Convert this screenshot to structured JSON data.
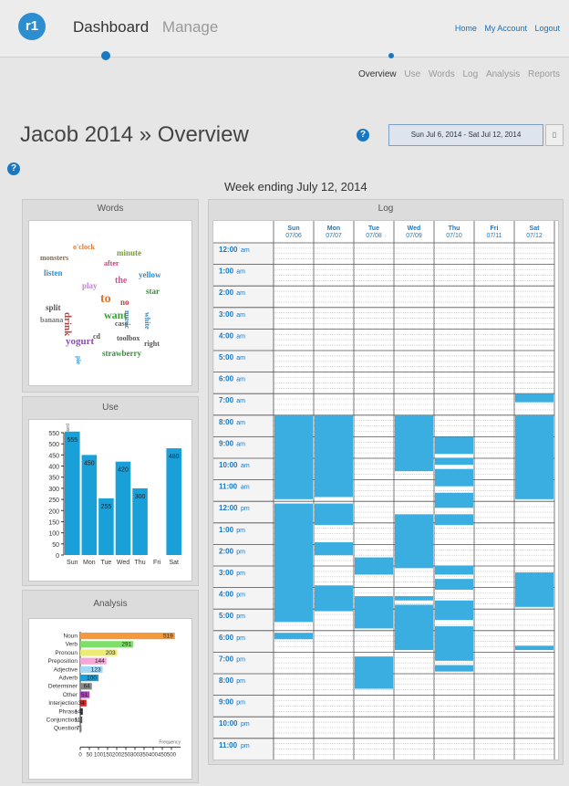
{
  "nav": {
    "dashboard": "Dashboard",
    "manage": "Manage",
    "home": "Home",
    "account": "My Account",
    "logout": "Logout",
    "logo_text": "r1"
  },
  "subnav": [
    "Overview",
    "Use",
    "Words",
    "Log",
    "Analysis",
    "Reports"
  ],
  "page_title": "Jacob 2014 » Overview",
  "help_icon": "?",
  "date_range": "Sun Jul 6, 2014 - Sat Jul 12, 2014",
  "week_heading": "Week ending July 12, 2014",
  "panels": {
    "words": "Words",
    "use": "Use",
    "analysis": "Analysis",
    "log": "Log"
  },
  "word_cloud": [
    {
      "t": "o'clock",
      "c": "#e0762a"
    },
    {
      "t": "monsters",
      "c": "#8a6a4a"
    },
    {
      "t": "minute",
      "c": "#7a9a3a"
    },
    {
      "t": "after",
      "c": "#c04080"
    },
    {
      "t": "listen",
      "c": "#2d8ecf"
    },
    {
      "t": "yellow",
      "c": "#2d8ecf"
    },
    {
      "t": "the",
      "c": "#d84c9c"
    },
    {
      "t": "play",
      "c": "#c080e0"
    },
    {
      "t": "star",
      "c": "#3a8a3a"
    },
    {
      "t": "to",
      "c": "#e0762a"
    },
    {
      "t": "no",
      "c": "#c04040"
    },
    {
      "t": "split",
      "c": "#555"
    },
    {
      "t": "want",
      "c": "#3aa03a"
    },
    {
      "t": "banana",
      "c": "#777"
    },
    {
      "t": "case",
      "c": "#555"
    },
    {
      "t": "drink",
      "c": "#c04040"
    },
    {
      "t": "cd",
      "c": "#555"
    },
    {
      "t": "toolbox",
      "c": "#555"
    },
    {
      "t": "yogurt",
      "c": "#8a50b0"
    },
    {
      "t": "right",
      "c": "#555"
    },
    {
      "t": "strawberry",
      "c": "#3a8a3a"
    },
    {
      "t": "music",
      "c": "#2d8ecf"
    },
    {
      "t": "white",
      "c": "#2d8ecf"
    },
    {
      "t": "pie",
      "c": "#2d8ecf"
    }
  ],
  "use_chart": {
    "ylabel": "Minutes used",
    "yticks": [
      0,
      50,
      100,
      150,
      200,
      250,
      300,
      350,
      400,
      450,
      500,
      550
    ],
    "categories": [
      "Sun",
      "Mon",
      "Tue",
      "Wed",
      "Thu",
      "Fri",
      "Sat"
    ],
    "values": [
      555,
      450,
      255,
      420,
      300,
      0,
      480
    ],
    "labels": [
      "555",
      "450",
      "255",
      "420",
      "300",
      "",
      "480"
    ],
    "color": "#1aa0d8"
  },
  "chart_data": [
    {
      "type": "bar",
      "title": "Use",
      "ylabel": "Minutes used",
      "categories": [
        "Sun",
        "Mon",
        "Tue",
        "Wed",
        "Thu",
        "Fri",
        "Sat"
      ],
      "values": [
        555,
        450,
        255,
        420,
        300,
        0,
        480
      ],
      "ylim": [
        0,
        550
      ]
    },
    {
      "type": "bar",
      "title": "Analysis",
      "xlabel": "Frequency",
      "categories": [
        "Noun",
        "Verb",
        "Pronoun",
        "Preposition",
        "Adjective",
        "Adverb",
        "Determiner",
        "Other",
        "Interjection",
        "Phrase",
        "Conjunction",
        "Question"
      ],
      "values": [
        519,
        291,
        203,
        144,
        123,
        100,
        64,
        51,
        34,
        14,
        11,
        7
      ]
    }
  ],
  "analysis_chart": {
    "xlabel": "Frequency",
    "xticks": [
      "0",
      "50",
      "100",
      "150",
      "200",
      "250",
      "300",
      "350",
      "400",
      "450",
      "500"
    ],
    "rows": [
      {
        "label": "Noun",
        "value": 519,
        "display": "519",
        "color": "#f59a3c"
      },
      {
        "label": "Verb",
        "value": 291,
        "display": "291",
        "color": "#7ee06a"
      },
      {
        "label": "Pronoun",
        "value": 203,
        "display": "203",
        "color": "#ecec74"
      },
      {
        "label": "Preposition",
        "value": 144,
        "display": "144",
        "color": "#f6a6d8"
      },
      {
        "label": "Adjective",
        "value": 123,
        "display": "123",
        "color": "#a4d8f4"
      },
      {
        "label": "Adverb",
        "value": 100,
        "display": "100",
        "color": "#1aa0d8"
      },
      {
        "label": "Determiner",
        "value": 64,
        "display": "64",
        "color": "#888888"
      },
      {
        "label": "Other",
        "value": 51,
        "display": "51",
        "color": "#b03cc0"
      },
      {
        "label": "Interjection",
        "value": 34,
        "display": "34",
        "color": "#e02020"
      },
      {
        "label": "Phrase",
        "value": 14,
        "display": "14",
        "color": "#333333"
      },
      {
        "label": "Conjunction",
        "value": 11,
        "display": "11",
        "color": "#555555"
      },
      {
        "label": "Question",
        "value": 7,
        "display": "7",
        "color": "#777777"
      }
    ]
  },
  "log": {
    "days": [
      {
        "d": "Sun",
        "dt": "07/06"
      },
      {
        "d": "Mon",
        "dt": "07/07"
      },
      {
        "d": "Tue",
        "dt": "07/08"
      },
      {
        "d": "Wed",
        "dt": "07/09"
      },
      {
        "d": "Thu",
        "dt": "07/10"
      },
      {
        "d": "Fri",
        "dt": "07/11"
      },
      {
        "d": "Sat",
        "dt": "07/12"
      }
    ],
    "hours": [
      {
        "h": "12:00",
        "ap": "am"
      },
      {
        "h": "1:00",
        "ap": "am"
      },
      {
        "h": "2:00",
        "ap": "am"
      },
      {
        "h": "3:00",
        "ap": "am"
      },
      {
        "h": "4:00",
        "ap": "am"
      },
      {
        "h": "5:00",
        "ap": "am"
      },
      {
        "h": "6:00",
        "ap": "am"
      },
      {
        "h": "7:00",
        "ap": "am"
      },
      {
        "h": "8:00",
        "ap": "am"
      },
      {
        "h": "9:00",
        "ap": "am"
      },
      {
        "h": "10:00",
        "ap": "am"
      },
      {
        "h": "11:00",
        "ap": "am"
      },
      {
        "h": "12:00",
        "ap": "pm"
      },
      {
        "h": "1:00",
        "ap": "pm"
      },
      {
        "h": "2:00",
        "ap": "pm"
      },
      {
        "h": "3:00",
        "ap": "pm"
      },
      {
        "h": "4:00",
        "ap": "pm"
      },
      {
        "h": "5:00",
        "ap": "pm"
      },
      {
        "h": "6:00",
        "ap": "pm"
      },
      {
        "h": "7:00",
        "ap": "pm"
      },
      {
        "h": "8:00",
        "ap": "pm"
      },
      {
        "h": "9:00",
        "ap": "pm"
      },
      {
        "h": "10:00",
        "ap": "pm"
      },
      {
        "h": "11:00",
        "ap": "pm"
      }
    ],
    "fill_color": "#3aaee0",
    "blocks": [
      [
        0,
        8,
        11.9
      ],
      [
        0,
        12.1,
        17.6
      ],
      [
        0,
        18.1,
        18.4
      ],
      [
        1,
        8,
        11.8
      ],
      [
        1,
        12.1,
        13.1
      ],
      [
        1,
        13.9,
        14.5
      ],
      [
        1,
        15.9,
        17.1
      ],
      [
        2,
        14.6,
        15.4
      ],
      [
        2,
        16.4,
        17.9
      ],
      [
        2,
        19.2,
        20.7
      ],
      [
        3,
        8,
        10.6
      ],
      [
        3,
        12.6,
        15.1
      ],
      [
        3,
        16.4,
        16.6
      ],
      [
        3,
        16.8,
        18.9
      ],
      [
        4,
        9.0,
        9.8
      ],
      [
        4,
        10.0,
        10.3
      ],
      [
        4,
        10.5,
        11.3
      ],
      [
        4,
        11.6,
        12.3
      ],
      [
        4,
        12.6,
        13.1
      ],
      [
        4,
        15.0,
        15.4
      ],
      [
        4,
        15.6,
        16.1
      ],
      [
        4,
        16.6,
        17.5
      ],
      [
        4,
        17.8,
        19.4
      ],
      [
        4,
        19.6,
        19.9
      ],
      [
        6,
        7.0,
        7.4
      ],
      [
        6,
        8,
        11.9
      ],
      [
        6,
        15.3,
        16.9
      ],
      [
        6,
        18.7,
        18.9
      ]
    ]
  }
}
